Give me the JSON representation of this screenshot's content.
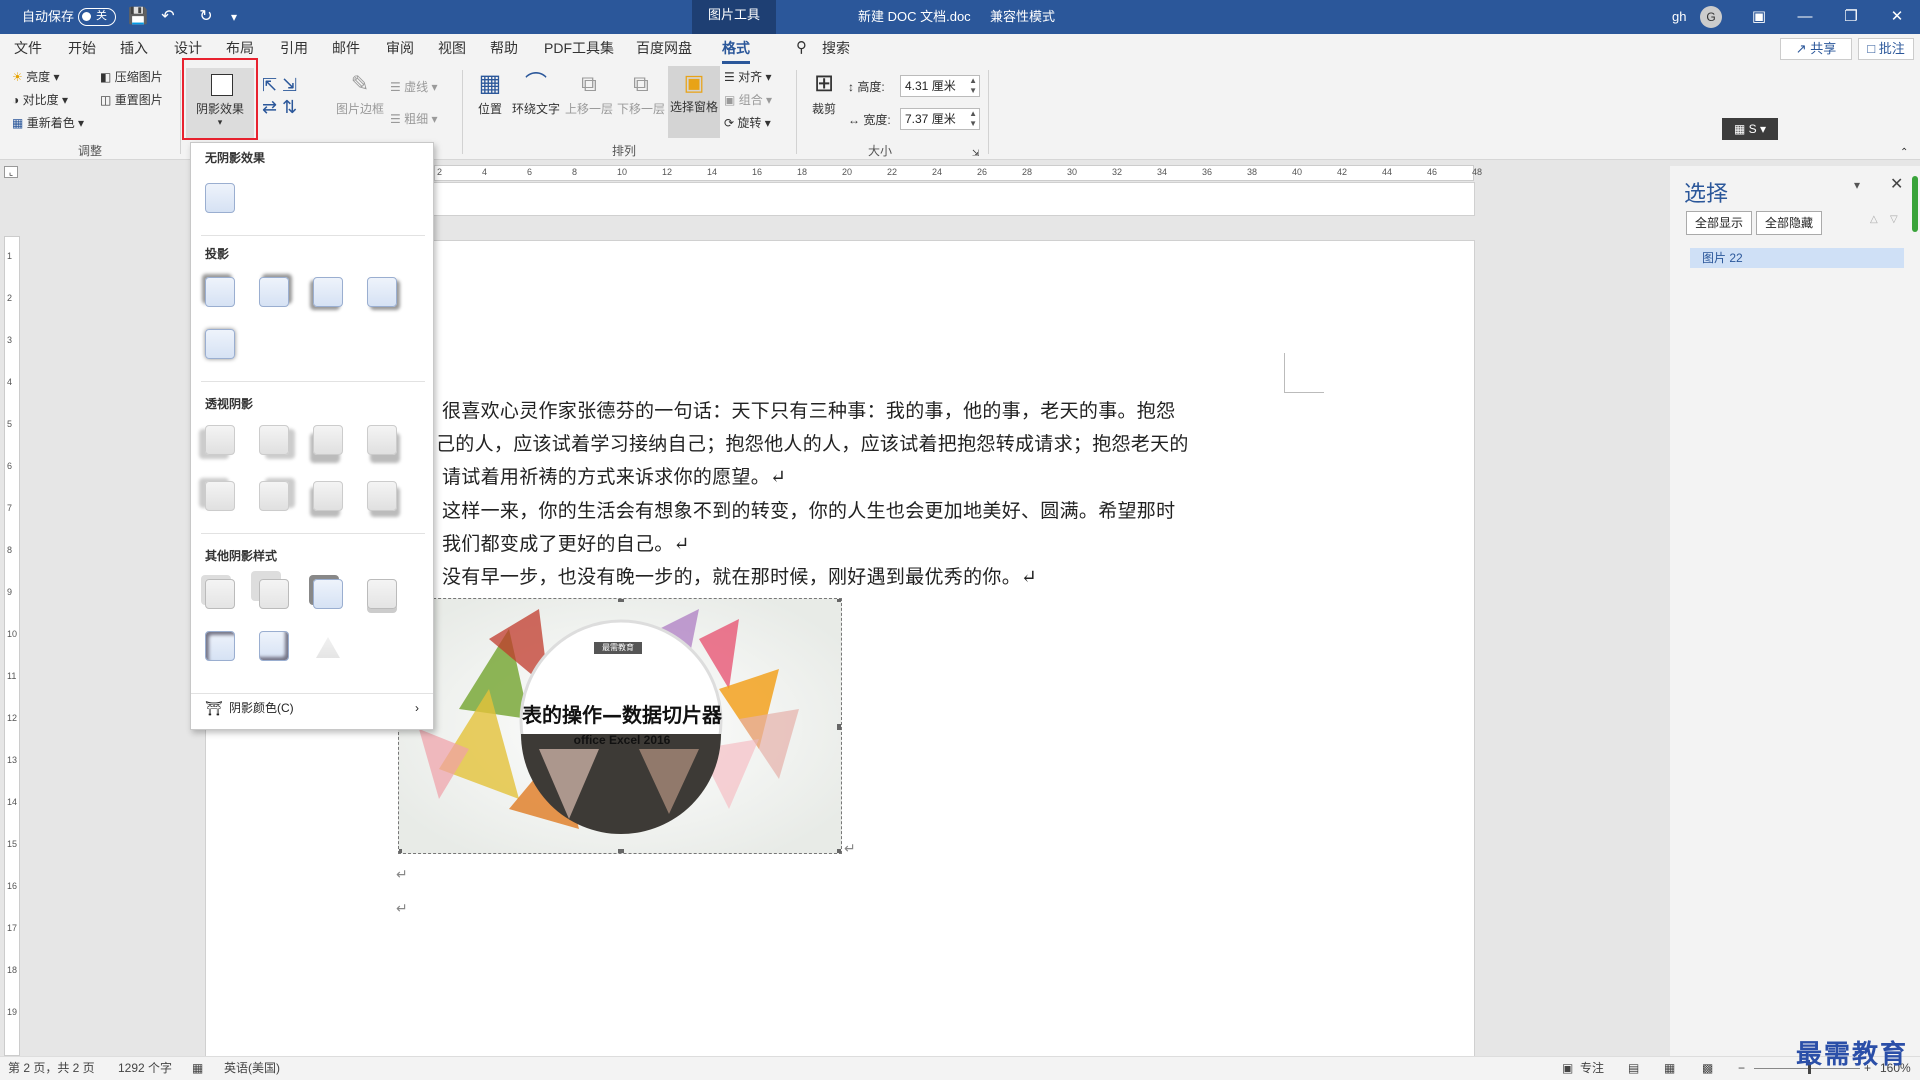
{
  "titlebar": {
    "autosave_label": "自动保存",
    "autosave_state": "关",
    "picture_tools": "图片工具",
    "doc_title": "新建 DOC 文档.doc",
    "mode": "兼容性模式",
    "user": "gh",
    "user_initial": "G"
  },
  "menu": {
    "tabs": [
      "文件",
      "开始",
      "插入",
      "设计",
      "布局",
      "引用",
      "邮件",
      "审阅",
      "视图",
      "帮助",
      "PDF工具集",
      "百度网盘",
      "格式"
    ],
    "search": "搜索",
    "share": "共享",
    "comment": "批注"
  },
  "ribbon": {
    "adjust": {
      "brightness": "亮度",
      "contrast": "对比度",
      "recolor": "重新着色",
      "compress": "压缩图片",
      "reset": "重置图片",
      "label": "调整"
    },
    "shadow_effects": "阴影效果",
    "border": {
      "picture_border": "图片边框",
      "dashes": "虚线",
      "weight": "粗细"
    },
    "arrange": {
      "position": "位置",
      "wrap_text": "环绕文字",
      "bring_forward": "上移一层",
      "send_backward": "下移一层",
      "selection_pane": "选择窗格",
      "align": "对齐",
      "group": "组合",
      "rotate": "旋转",
      "label": "排列"
    },
    "size": {
      "crop": "裁剪",
      "height_label": "高度:",
      "height_value": "4.31 厘米",
      "width_label": "宽度:",
      "width_value": "7.37 厘米",
      "label": "大小"
    }
  },
  "dropdown": {
    "no_shadow": "无阴影效果",
    "drop_shadow": "投影",
    "perspective_shadow": "透视阴影",
    "other_shadow": "其他阴影样式",
    "shadow_color": "阴影颜色(C)"
  },
  "document": {
    "lines": [
      "很喜欢心灵作家张德芬的一句话：天下只有三种事：我的事，他的事，老天的事。抱怨",
      "己的人，应该试着学习接纳自己；抱怨他人的人，应该试着把抱怨转成请求；抱怨老天的",
      "请试着用祈祷的方式来诉求你的愿望。↵",
      "这样一来，你的生活会有想象不到的转变，你的人生也会更加地美好、圆满。希望那时",
      "我们都变成了更好的自己。↵",
      "没有早一步，也没有晚一步的，就在那时候，刚好遇到最优秀的你。↵"
    ],
    "image": {
      "tag": "最需教育",
      "title": "表的操作—数据切片器",
      "subtitle": "office Excel 2016"
    },
    "empty_para_mark": "↵"
  },
  "ruler_ticks": [
    "2",
    "4",
    "6",
    "8",
    "10",
    "12",
    "14",
    "16",
    "18",
    "20",
    "22",
    "24",
    "26",
    "28",
    "30",
    "32",
    "34",
    "36",
    "38",
    "40",
    "42",
    "44",
    "46",
    "48"
  ],
  "vruler_ticks": [
    "1",
    "2",
    "3",
    "4",
    "5",
    "6",
    "7",
    "8",
    "9",
    "10",
    "11",
    "12",
    "13",
    "14",
    "15",
    "16",
    "17",
    "18",
    "19"
  ],
  "selection_pane": {
    "title": "选择",
    "show_all": "全部显示",
    "hide_all": "全部隐藏",
    "items": [
      "图片 22"
    ]
  },
  "status": {
    "page": "第 2 页，共 2 页",
    "words": "1292 个字",
    "lang": "英语(美国)",
    "focus": "专注",
    "zoom": "160%"
  },
  "watermark": "最需教育"
}
